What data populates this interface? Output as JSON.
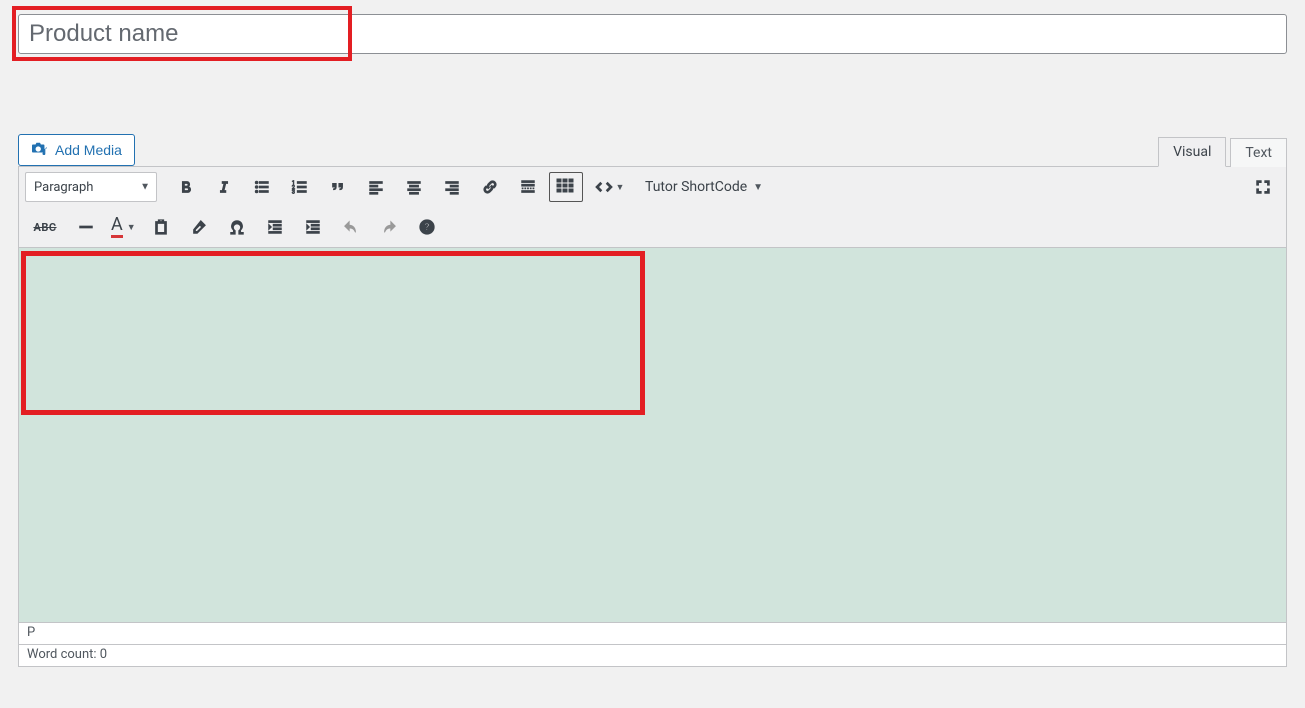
{
  "title": {
    "placeholder": "Product name",
    "value": ""
  },
  "buttons": {
    "add_media": "Add Media"
  },
  "tabs": {
    "visual": "Visual",
    "text": "Text",
    "active": "visual"
  },
  "toolbar": {
    "format_select": "Paragraph",
    "shortcode_menu": "Tutor ShortCode",
    "strike_label": "ABC",
    "color_A": "A"
  },
  "editor": {
    "content": ""
  },
  "status": {
    "path": "P",
    "word_count_label": "Word count: ",
    "word_count_value": "0"
  },
  "colors": {
    "accent": "#2271b1",
    "highlight": "#e31e23",
    "canvas": "#d1e4dc"
  }
}
